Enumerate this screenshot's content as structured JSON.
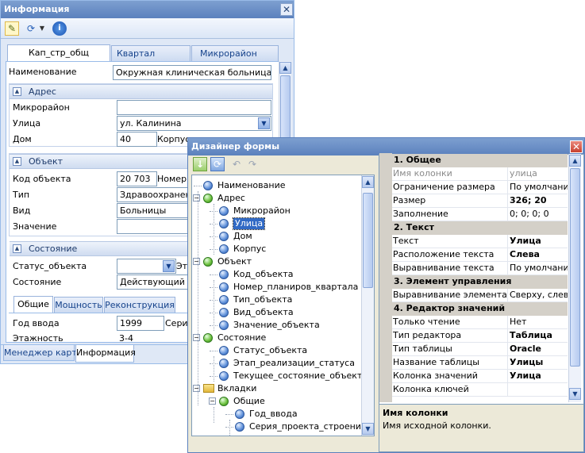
{
  "left_window": {
    "title": "Информация",
    "close": "✕",
    "tabs": [
      "Кап_стр_общ",
      "Квартал",
      "Микрорайон"
    ],
    "name_label": "Наименование",
    "name_value": "Окружная клиническая больница. У ХМ",
    "groups": {
      "address": "Адрес",
      "object": "Объект",
      "state": "Состояние"
    },
    "address": {
      "microdistrict_label": "Микрорайон",
      "microdistrict_value": "",
      "street_label": "Улица",
      "street_value": "ул. Калинина",
      "house_label": "Дом",
      "house_value": "40",
      "korpus_label": "Корпус"
    },
    "object": {
      "code_label": "Код объекта",
      "code_value": "20 703",
      "plan_label": "Номер к",
      "type_label": "Тип",
      "type_value": "Здравоохранение",
      "kind_label": "Вид",
      "kind_value": "Больницы",
      "value_label": "Значение",
      "value_value": ""
    },
    "state": {
      "status_label": "Статус_объекта",
      "status_value": "",
      "status_extra": "Эта",
      "state_label": "Состояние",
      "state_value": "Действующий"
    },
    "subtabs": [
      "Общие",
      "Мощность",
      "Реконструкция"
    ],
    "general": {
      "year_label": "Год ввода",
      "year_value": "1999",
      "series_label": "Серия",
      "floors_label": "Этажность",
      "floors_value": "3-4"
    },
    "bottom_tabs": [
      "Менеджер карт",
      "Информация"
    ]
  },
  "designer": {
    "title": "Дизайнер формы",
    "close": "✕",
    "tree": [
      {
        "label": "Наименование",
        "depth": 1,
        "icon": "orb-blue"
      },
      {
        "label": "Адрес",
        "depth": 0,
        "icon": "orb-green",
        "expander": "−"
      },
      {
        "label": "Микрорайон",
        "depth": 2,
        "icon": "orb-blue"
      },
      {
        "label": "Улица",
        "depth": 2,
        "icon": "orb-blue",
        "selected": true
      },
      {
        "label": "Дом",
        "depth": 2,
        "icon": "orb-blue"
      },
      {
        "label": "Корпус",
        "depth": 2,
        "icon": "orb-blue"
      },
      {
        "label": "Объект",
        "depth": 0,
        "icon": "orb-green",
        "expander": "−"
      },
      {
        "label": "Код_объекта",
        "depth": 2,
        "icon": "orb-blue"
      },
      {
        "label": "Номер_планиров_квартала",
        "depth": 2,
        "icon": "orb-blue"
      },
      {
        "label": "Тип_объекта",
        "depth": 2,
        "icon": "orb-blue"
      },
      {
        "label": "Вид_объекта",
        "depth": 2,
        "icon": "orb-blue"
      },
      {
        "label": "Значение_объекта",
        "depth": 2,
        "icon": "orb-blue"
      },
      {
        "label": "Состояние",
        "depth": 0,
        "icon": "orb-green",
        "expander": "−"
      },
      {
        "label": "Статус_объекта",
        "depth": 2,
        "icon": "orb-blue"
      },
      {
        "label": "Этап_реализации_статуса",
        "depth": 2,
        "icon": "orb-blue"
      },
      {
        "label": "Текущее_состояние_объекта",
        "depth": 2,
        "icon": "orb-blue"
      },
      {
        "label": "Вкладки",
        "depth": 0,
        "icon": "folder",
        "expander": "−"
      },
      {
        "label": "Общие",
        "depth": 1,
        "icon": "orb-green",
        "expander": "−"
      },
      {
        "label": "Год_ввода",
        "depth": 3,
        "icon": "orb-blue"
      },
      {
        "label": "Серия_проекта_строения",
        "depth": 3,
        "icon": "orb-blue"
      }
    ],
    "categories": {
      "general": "1. Общее",
      "text": "2. Текст",
      "control": "3. Элемент управления",
      "editor": "4. Редактор значений"
    },
    "props": {
      "column_name": {
        "name": "Имя колонки",
        "value": "улица"
      },
      "size_limit": {
        "name": "Ограничение размера",
        "value": "По умолчанию"
      },
      "size": {
        "name": "Размер",
        "value": "326; 20"
      },
      "padding": {
        "name": "Заполнение",
        "value": "0; 0; 0; 0"
      },
      "text": {
        "name": "Текст",
        "value": "Улица"
      },
      "text_pos": {
        "name": "Расположение текста",
        "value": "Слева"
      },
      "text_align": {
        "name": "Выравнивание текста",
        "value": "По умолчанию"
      },
      "elem_align": {
        "name": "Выравнивание элемента",
        "value": "Сверху, слева"
      },
      "readonly": {
        "name": "Только чтение",
        "value": "Нет"
      },
      "editor_type": {
        "name": "Тип редактора",
        "value": "Таблица"
      },
      "table_type": {
        "name": "Тип таблицы",
        "value": "Oracle"
      },
      "table_name": {
        "name": "Название таблицы",
        "value": "Улицы"
      },
      "value_col": {
        "name": "Колонка значений",
        "value": "Улица"
      },
      "key_col": {
        "name": "Колонка ключей",
        "value": ""
      }
    },
    "desc_title": "Имя колонки",
    "desc_text": "Имя исходной колонки."
  }
}
